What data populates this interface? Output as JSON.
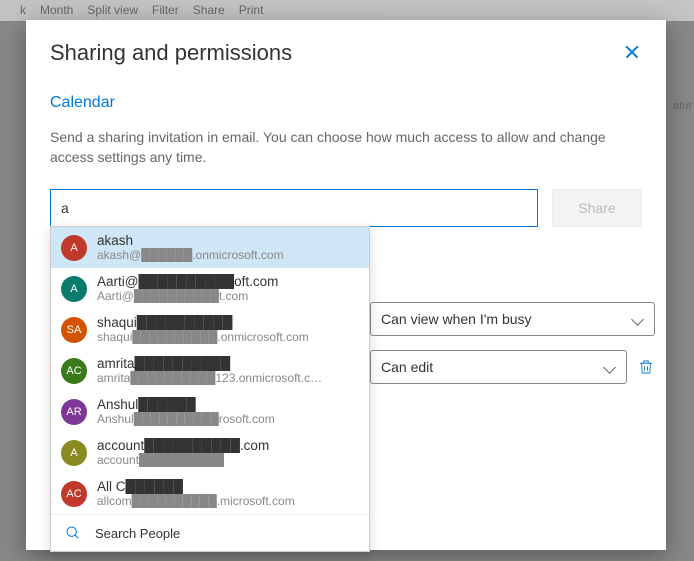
{
  "bg_toolbar": [
    "k",
    "Month",
    "Split view",
    "Filter",
    "Share",
    "Print"
  ],
  "modal": {
    "title": "Sharing and permissions",
    "section": "Calendar",
    "help": "Send a sharing invitation in email. You can choose how much access to allow and change access settings any time.",
    "input_value": "a",
    "share_label": "Share"
  },
  "suggestions": [
    {
      "name": "akash",
      "email": "akash@██████.onmicrosoft.com",
      "initials": "A",
      "color": "#c0392b",
      "selected": true
    },
    {
      "name": "Aarti@██████████oft.com",
      "email": "Aarti@██████████t.com",
      "initials": "A",
      "color": "#0b7c6b"
    },
    {
      "name": "shaqui██████████",
      "email": "shaqui██████████.onmicrosoft.com",
      "initials": "SA",
      "color": "#d35400"
    },
    {
      "name": "amrita██████████",
      "email": "amrita██████████123.onmicrosoft.c…",
      "initials": "AC",
      "color": "#3b7a1a"
    },
    {
      "name": "Anshul██████",
      "email": "Anshul██████████rosoft.com",
      "initials": "AR",
      "color": "#7e3794"
    },
    {
      "name": "account██████████.com",
      "email": "account██████████",
      "initials": "A",
      "color": "#8a8a22"
    },
    {
      "name": "All C██████",
      "email": "allcom██████████.microsoft.com",
      "initials": "AC",
      "color": "#c0392b"
    }
  ],
  "search_people_label": "Search People",
  "permissions": [
    {
      "label": "Can view when I'm busy",
      "deletable": false
    },
    {
      "label": "Can edit",
      "deletable": true
    }
  ]
}
